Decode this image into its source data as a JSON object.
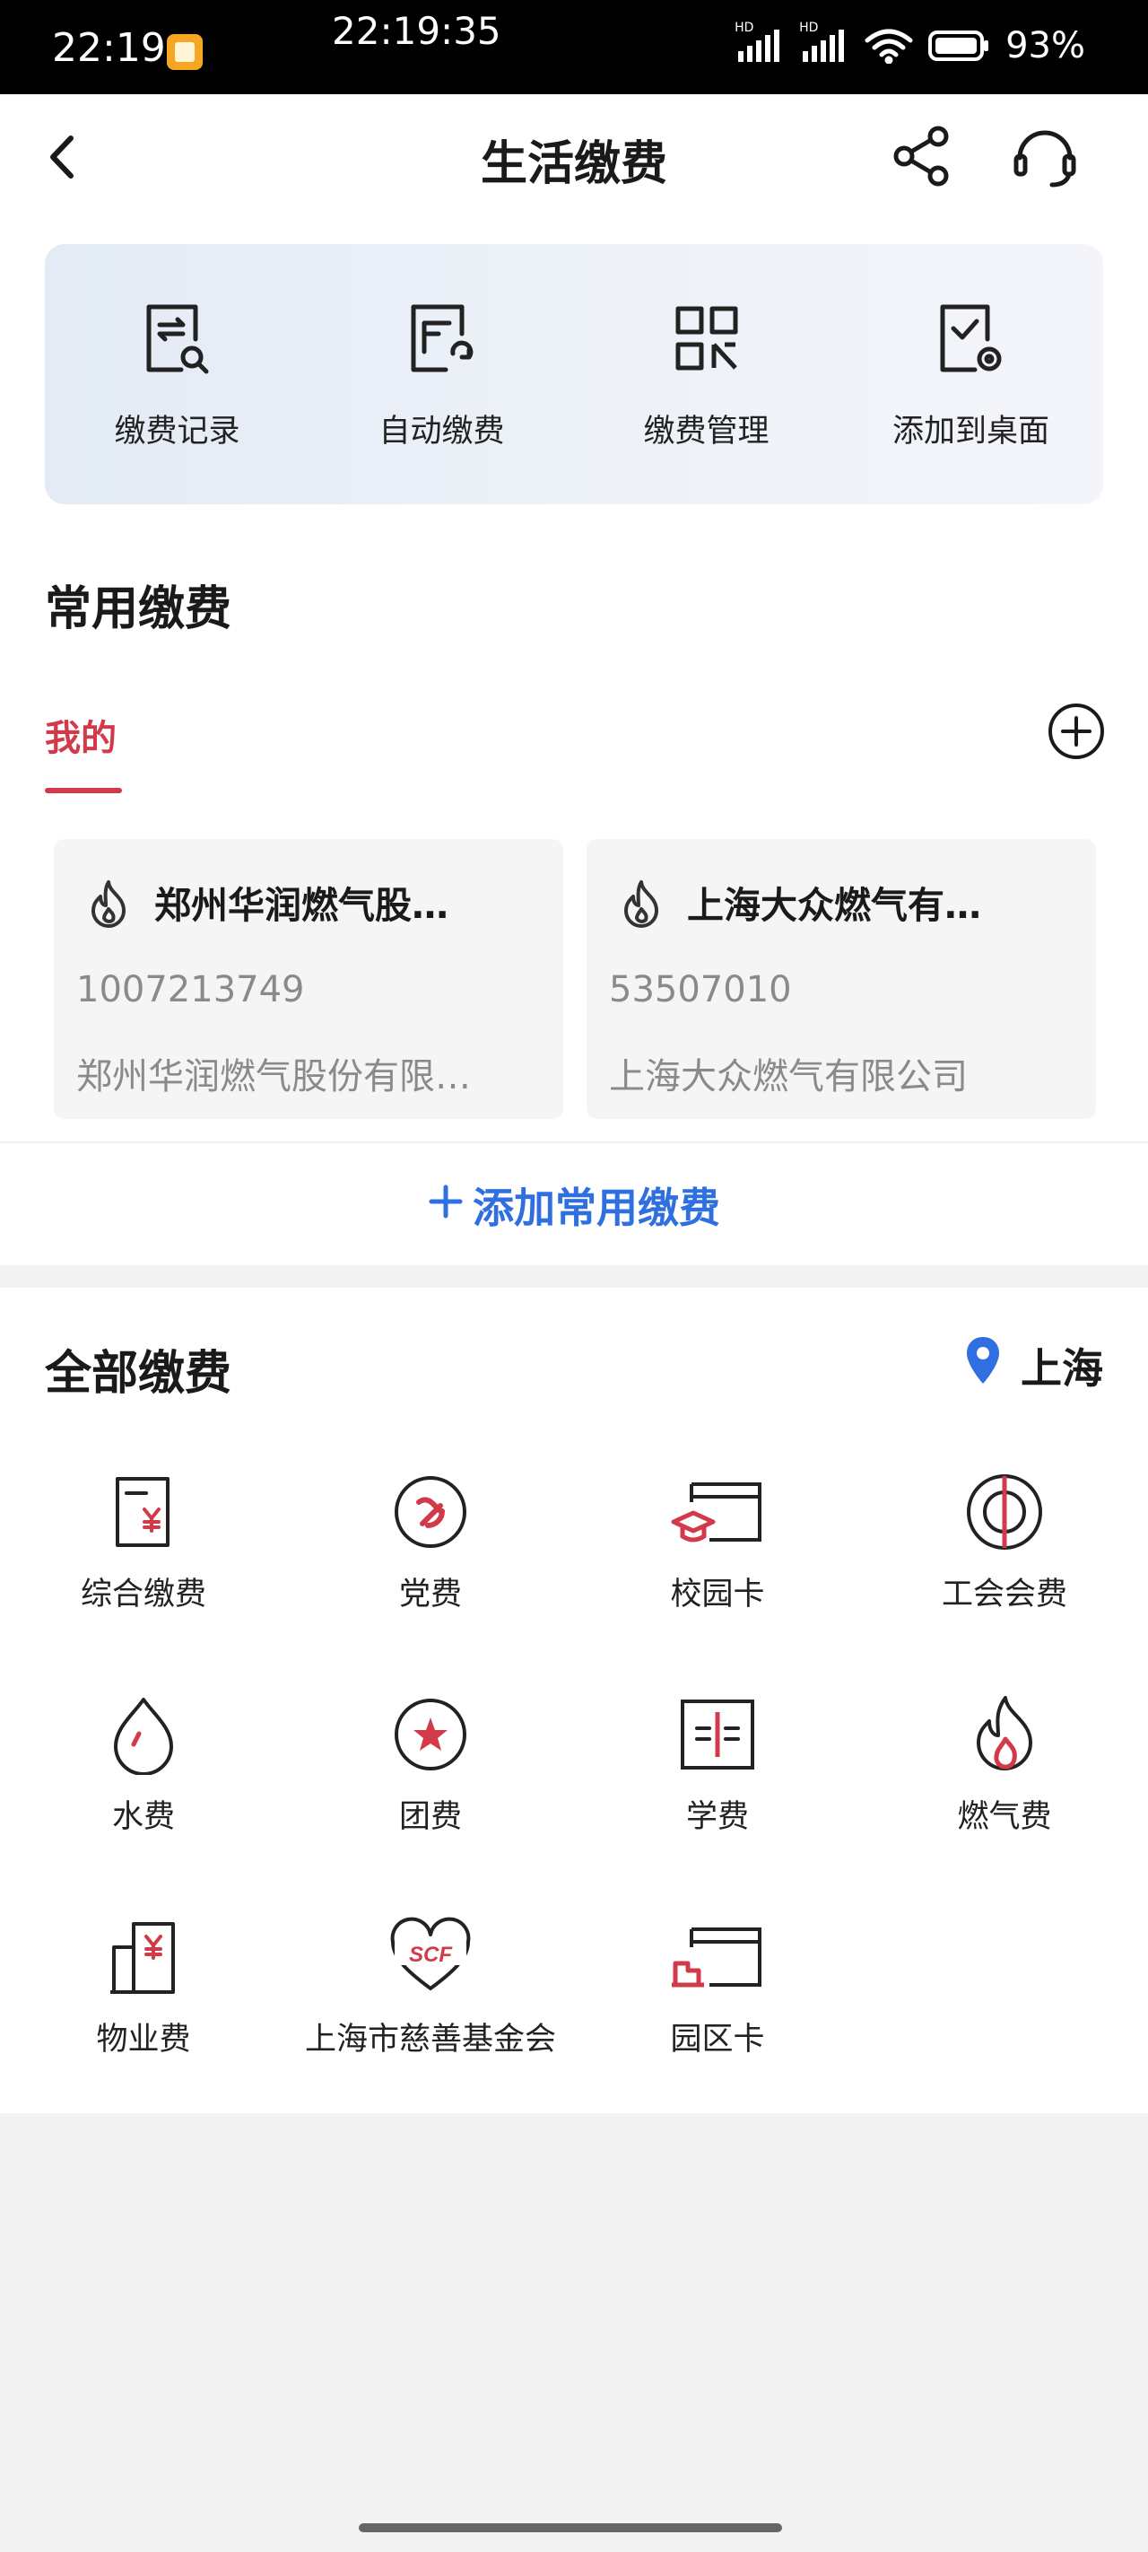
{
  "status_bar": {
    "time": "22:19",
    "center_time": "22:19:35",
    "signal1": "HD",
    "signal2": "HD",
    "battery": "93%"
  },
  "header": {
    "title": "生活缴费",
    "icons": [
      "back-icon",
      "share-icon",
      "customer-service-icon"
    ]
  },
  "quick_actions": [
    {
      "label": "缴费记录",
      "icon": "payment-record-icon"
    },
    {
      "label": "自动缴费",
      "icon": "auto-pay-icon"
    },
    {
      "label": "缴费管理",
      "icon": "qr-manage-icon"
    },
    {
      "label": "添加到桌面",
      "icon": "add-to-desktop-icon"
    }
  ],
  "common": {
    "title": "常用缴费",
    "tab": "我的",
    "cards": [
      {
        "title": "郑州华润燃气股…",
        "number": "1007213749",
        "company": "郑州华润燃气股份有限…",
        "icon": "flame-icon"
      },
      {
        "title": "上海大众燃气有…",
        "number": "53507010",
        "company": "上海大众燃气有限公司",
        "icon": "flame-icon"
      }
    ],
    "add_label": "添加常用缴费"
  },
  "all": {
    "title": "全部缴费",
    "location": "上海",
    "items": [
      {
        "label": "综合缴费",
        "icon": "bill-yen-icon"
      },
      {
        "label": "党费",
        "icon": "party-emblem-icon"
      },
      {
        "label": "校园卡",
        "icon": "campus-card-icon"
      },
      {
        "label": "工会会费",
        "icon": "union-emblem-icon"
      },
      {
        "label": "水费",
        "icon": "water-drop-icon"
      },
      {
        "label": "团费",
        "icon": "league-star-icon"
      },
      {
        "label": "学费",
        "icon": "tuition-book-icon"
      },
      {
        "label": "燃气费",
        "icon": "gas-flame-icon"
      },
      {
        "label": "物业费",
        "icon": "property-building-icon"
      },
      {
        "label": "上海市慈善基金会",
        "icon": "scf-heart-icon"
      },
      {
        "label": "园区卡",
        "icon": "park-card-icon"
      }
    ]
  },
  "colors": {
    "accent_red": "#d23a4a",
    "link_blue": "#2f6fe0",
    "location_blue": "#2f6fe0"
  }
}
